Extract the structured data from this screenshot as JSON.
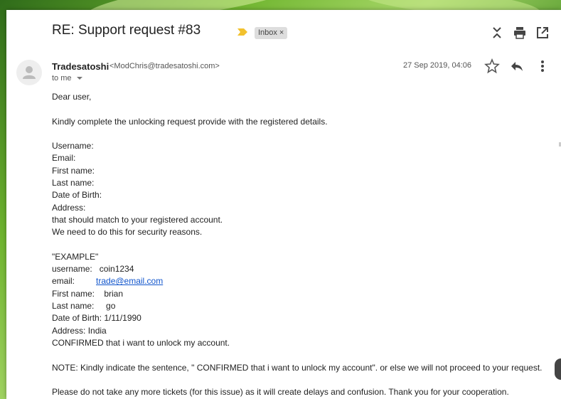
{
  "email": {
    "subject": "RE: Support request #83",
    "label": "Inbox",
    "label_remove": "×",
    "sender_name": "Tradesatoshi",
    "sender_email": "<ModChris@tradesatoshi.com>",
    "to_line": "to me",
    "date": "27 Sep 2019, 04:06"
  },
  "icons": {
    "collapse": "collapse-all-icon",
    "print": "print-icon",
    "open_new": "open-in-new-window-icon",
    "star": "star-icon",
    "reply": "reply-icon",
    "more": "more-vert-icon",
    "avatar": "person-avatar-icon",
    "important": "important-marker-icon"
  },
  "colors": {
    "important_marker": "#f2c12e",
    "link": "#1155cc",
    "label_chip": "#dddddd"
  },
  "body": {
    "greeting": "Dear user,",
    "intro": "Kindly complete the unlocking request provide with the registered details.",
    "fields": [
      "Username:",
      "Email:",
      "First name:",
      "Last name:",
      "Date of Birth:",
      "Address:"
    ],
    "match_note": "that should match to your registered account.",
    "security_note": "We need to do this for security reasons.",
    "example_title": "\"EXAMPLE\"",
    "example_username": "username:   coin1234",
    "example_email_label": "email:         ",
    "example_email_link": "trade@email.com",
    "example_first": "First name:    brian",
    "example_last": "Last name:     go",
    "example_dob": "Date of Birth: 1/11/1990",
    "example_address": "Address: India",
    "example_confirm": "CONFIRMED that i want to unlock my account.",
    "note": "NOTE: Kindly indicate the sentence, \" CONFIRMED that i want to unlock my account\". or else we will not proceed to your request.",
    "closing": "Please do not take any more tickets (for this issue) as it will create delays and confusion. Thank you for your cooperation."
  }
}
